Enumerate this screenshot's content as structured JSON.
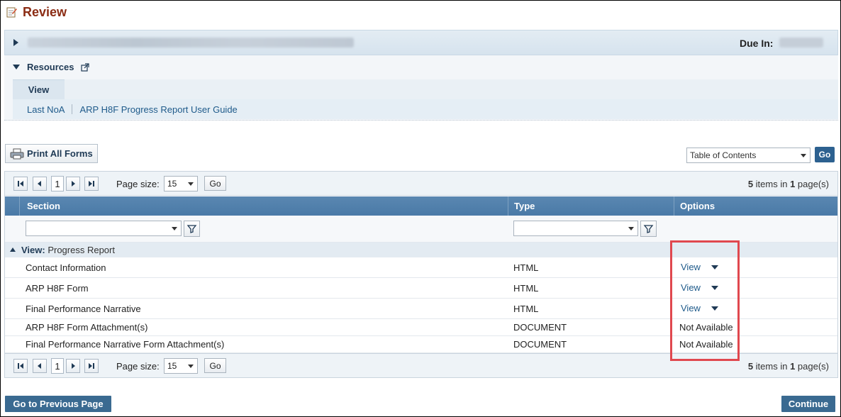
{
  "page": {
    "title": "Review"
  },
  "info_bar": {
    "due_label": "Due In:"
  },
  "resources": {
    "label": "Resources",
    "tab": "View",
    "links": [
      "Last NoA",
      "ARP H8F Progress Report User Guide"
    ]
  },
  "toolbar": {
    "print_label": "Print All Forms",
    "toc_value": "Table of Contents",
    "go_label": "Go"
  },
  "pager": {
    "current_page": "1",
    "page_size_label": "Page size:",
    "page_size_value": "15",
    "go_label": "Go",
    "items_count": "5",
    "items_text": " items in ",
    "page_count": "1",
    "pages_text": " page(s)"
  },
  "grid": {
    "columns": [
      "Section",
      "Type",
      "Options"
    ],
    "group": {
      "prefix": "View:",
      "name": " Progress Report"
    },
    "rows": [
      {
        "section": "Contact Information",
        "type": "HTML",
        "option": "View",
        "has_menu": true
      },
      {
        "section": "ARP H8F Form",
        "type": "HTML",
        "option": "View",
        "has_menu": true
      },
      {
        "section": "Final Performance Narrative",
        "type": "HTML",
        "option": "View",
        "has_menu": true
      },
      {
        "section": "ARP H8F Form Attachment(s)",
        "type": "DOCUMENT",
        "option": "Not Available",
        "has_menu": false
      },
      {
        "section": "Final Performance Narrative Form Attachment(s)",
        "type": "DOCUMENT",
        "option": "Not Available",
        "has_menu": false
      }
    ]
  },
  "footer": {
    "prev_label": "Go to Previous Page",
    "continue_label": "Continue"
  },
  "colors": {
    "title": "#8b2c14",
    "header_blue": "#4a7aa7",
    "link": "#1e5a8a",
    "highlight": "#e0484f",
    "button_dark": "#3a6a91"
  }
}
